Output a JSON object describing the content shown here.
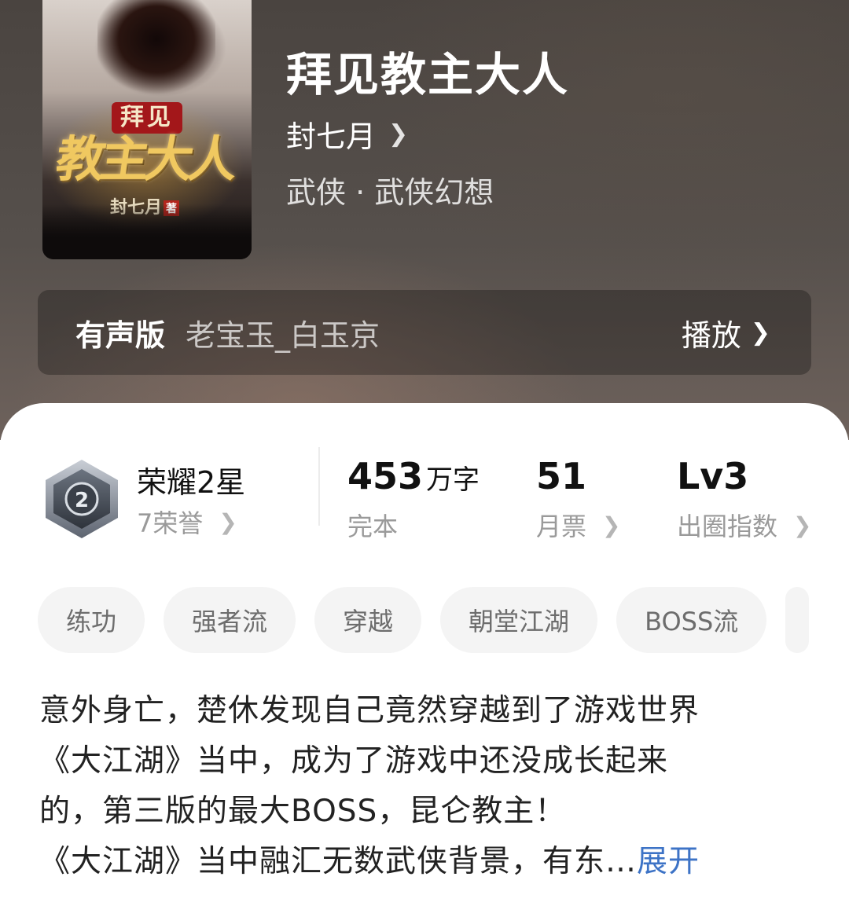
{
  "book": {
    "title": "拜见教主大人",
    "author": "封七月",
    "genre": "武侠 · 武侠幻想",
    "cover": {
      "top_text": "拜见",
      "main_text": "教主大人",
      "author_text": "封七月",
      "author_badge": "著"
    }
  },
  "audio": {
    "label": "有声版",
    "narrator": "老宝玉_白玉京",
    "play_label": "播放"
  },
  "stats": {
    "honor_title": "荣耀2星",
    "honor_sub": "7荣誉",
    "badge_level": "2",
    "words_num": "453",
    "words_unit": "万字",
    "words_sub": "完本",
    "tickets_num": "51",
    "tickets_sub": "月票",
    "influence_num": "Lv3",
    "influence_sub": "出圈指数"
  },
  "tags": [
    "练功",
    "强者流",
    "穿越",
    "朝堂江湖",
    "BOSS流"
  ],
  "description": {
    "line1": "意外身亡，楚休发现自己竟然穿越到了游戏世界",
    "line2": "《大江湖》当中，成为了游戏中还没成长起来",
    "line3": "的，第三版的最大BOSS，昆仑教主！",
    "line4": "《大江湖》当中融汇无数武侠背景，有东…",
    "expand_label": "展开"
  },
  "icons": {
    "chevron": "chevron-right-icon",
    "badge": "honor-badge-icon"
  },
  "colors": {
    "link": "#3d73c6",
    "tag_bg": "#f4f4f4"
  }
}
